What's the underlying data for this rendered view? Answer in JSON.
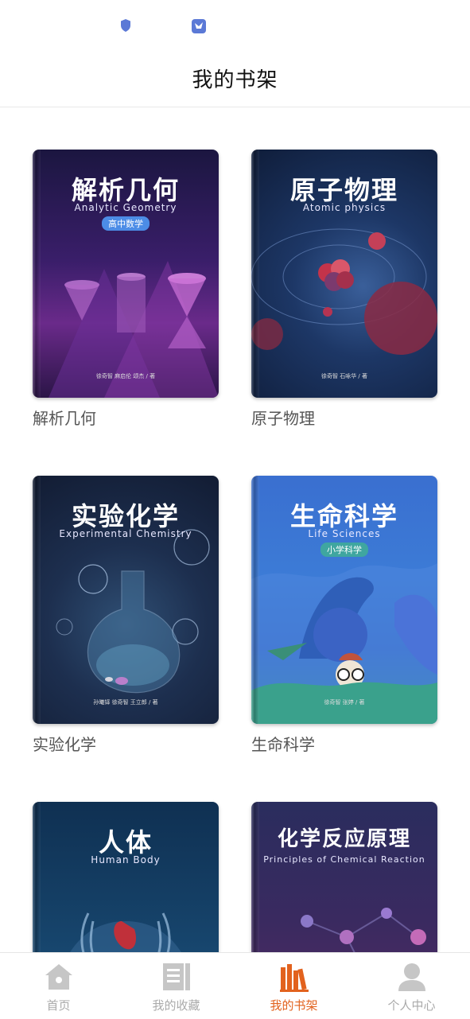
{
  "page": {
    "title": "我的书架"
  },
  "books": [
    {
      "name": "解析几何",
      "cover_title": "解析几何",
      "cover_subtitle": "Analytic Geometry",
      "cover_tag": "高中数学",
      "authors": "徐奇智 麻启伦 颂杰 / 著"
    },
    {
      "name": "原子物理",
      "cover_title": "原子物理",
      "cover_subtitle": "Atomic physics",
      "cover_tag": "",
      "authors": "徐奇智 石咏华 / 著"
    },
    {
      "name": "实验化学",
      "cover_title": "实验化学",
      "cover_subtitle": "Experimental Chemistry",
      "cover_tag": "",
      "authors": "孙曦铎 徐奇智 王立郎 / 著"
    },
    {
      "name": "生命科学",
      "cover_title": "生命科学",
      "cover_subtitle": "Life Sciences",
      "cover_tag": "小学科学",
      "authors": "徐奇智 张婷 / 著"
    },
    {
      "name": "人体",
      "cover_title": "人体",
      "cover_subtitle": "Human Body",
      "cover_tag": "",
      "authors": ""
    },
    {
      "name": "化学反应原理",
      "cover_title": "化学反应原理",
      "cover_subtitle": "Principles of Chemical Reaction",
      "cover_tag": "",
      "authors": ""
    }
  ],
  "tabbar": {
    "items": [
      {
        "label": "首页",
        "icon": "home-icon",
        "active": false
      },
      {
        "label": "我的收藏",
        "icon": "collection-icon",
        "active": false
      },
      {
        "label": "我的书架",
        "icon": "bookshelf-icon",
        "active": true
      },
      {
        "label": "个人中心",
        "icon": "user-icon",
        "active": false
      }
    ]
  },
  "colors": {
    "accent": "#e2621e",
    "inactive": "#aaaaaa"
  }
}
